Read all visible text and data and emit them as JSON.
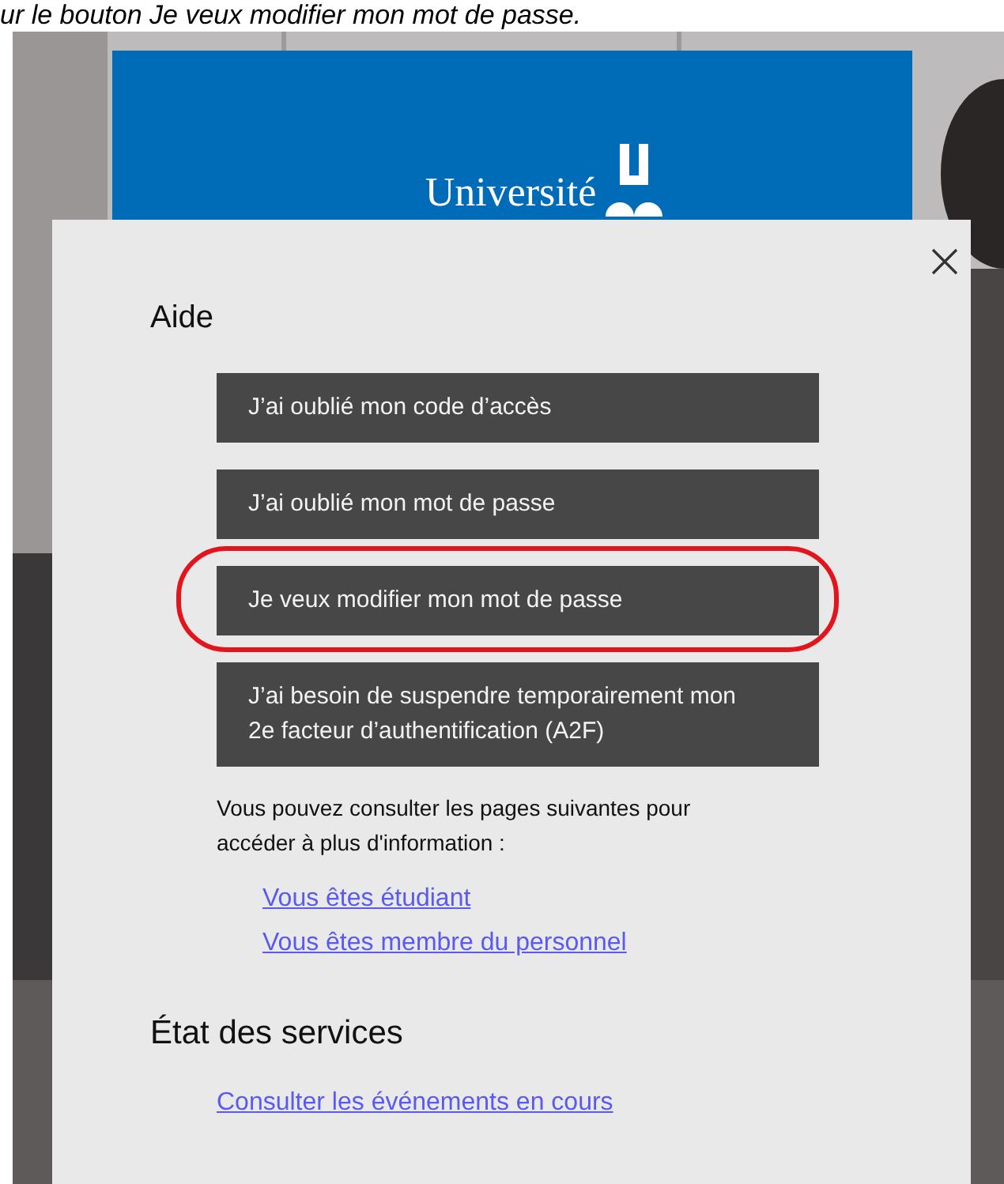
{
  "caption": "ur le bouton Je veux modifier mon mot de passe.",
  "logo": {
    "text": "Université"
  },
  "dialog": {
    "title": "Aide",
    "buttons": [
      {
        "label": "J’ai oublié mon code d’accès",
        "circled": false
      },
      {
        "label": "J’ai oublié mon mot de passe",
        "circled": false
      },
      {
        "label": "Je veux modifier mon mot de passe",
        "circled": true
      },
      {
        "label": "J’ai besoin de suspendre temporairement mon 2e facteur d’authentification (A2F)",
        "circled": false
      }
    ],
    "info": "Vous pouvez consulter les pages suivantes pour accéder à plus d'information :",
    "links": [
      "Vous êtes étudiant",
      "Vous êtes membre du personnel"
    ],
    "status_heading": "État des services",
    "status_link": "Consulter les événements en cours"
  }
}
